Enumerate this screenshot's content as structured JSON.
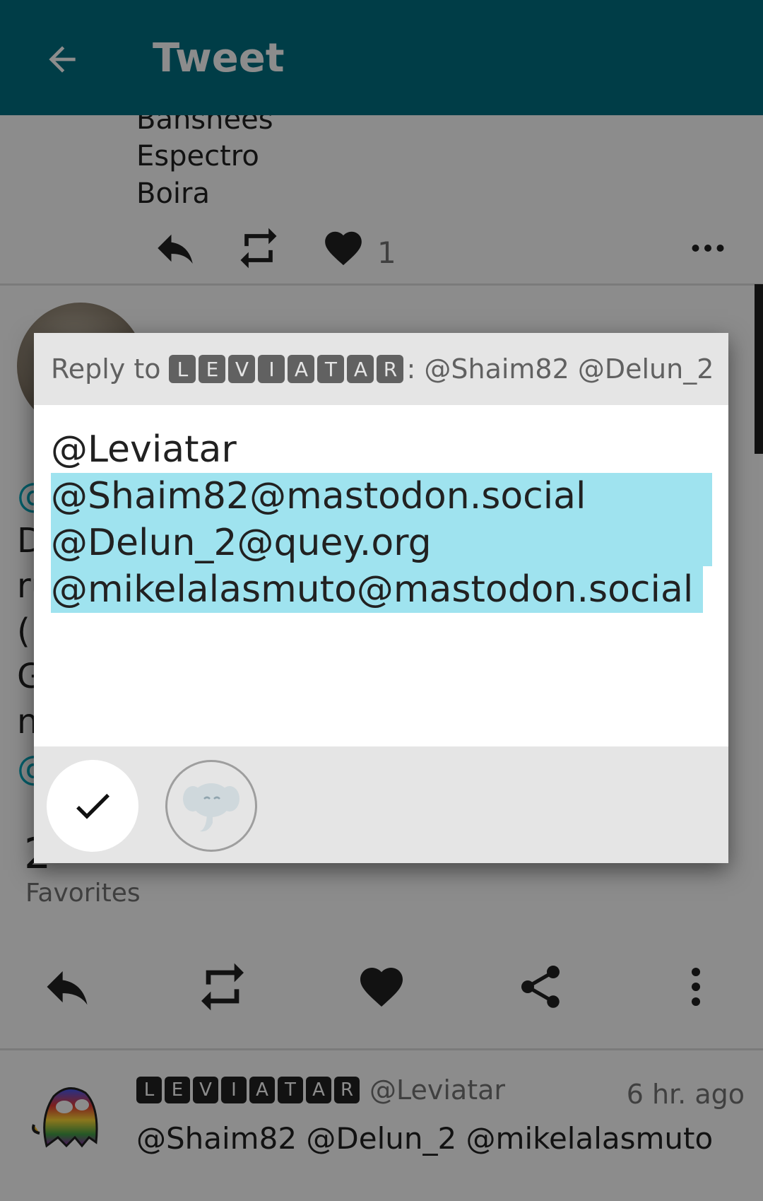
{
  "appbar": {
    "title": "Tweet",
    "back_icon": "arrow-back-icon"
  },
  "previous_post": {
    "lines": [
      "Banshees",
      "Espectro",
      "Boira"
    ],
    "favorites": "1"
  },
  "background_post": {
    "partial_lines": [
      "@",
      "D",
      "ru",
      "(",
      "G",
      "n",
      "@"
    ],
    "favorites_count": "2",
    "favorites_label": "Favorites"
  },
  "reply_item": {
    "display_name_letters": [
      "L",
      "E",
      "V",
      "I",
      "A",
      "T",
      "A",
      "R"
    ],
    "handle": "@Leviatar",
    "time": "6 hr. ago",
    "text": "@Shaim82 @Delun_2 @mikelalasmuto"
  },
  "dialog": {
    "header_prefix": "Reply to",
    "header_name_letters": [
      "L",
      "E",
      "V",
      "I",
      "A",
      "T",
      "A",
      "R"
    ],
    "header_suffix": ": @Shaim82 @Delun_2",
    "compose_line1": "@Leviatar",
    "compose_selected": [
      "@Shaim82@mastodon.social",
      "@Delun_2@quey.org",
      "@mikelalasmuto@mastodon.social"
    ]
  },
  "colors": {
    "appbar": "#006f82",
    "selection": "#9fe3ef",
    "mention": "#00acc1"
  }
}
